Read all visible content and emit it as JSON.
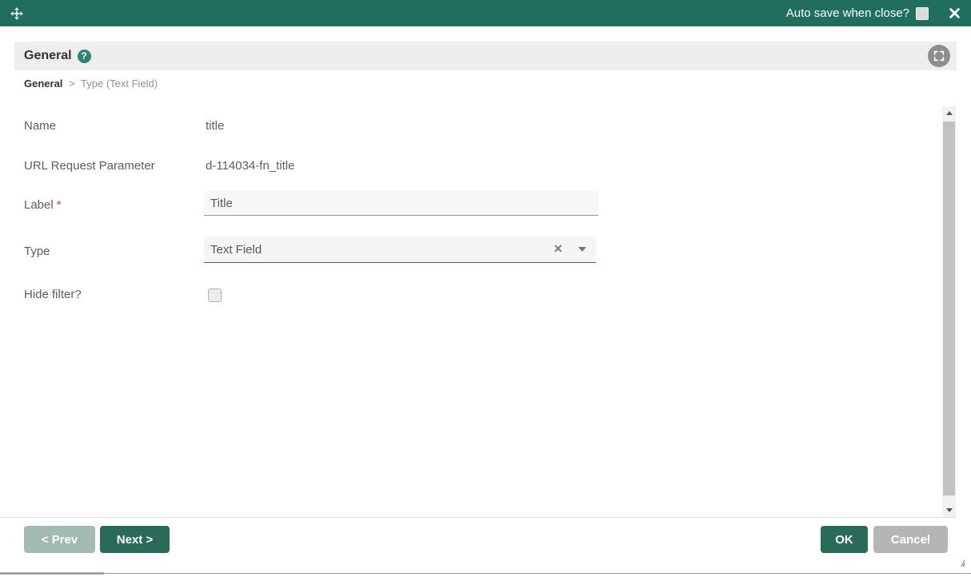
{
  "titlebar": {
    "autosave_label": "Auto save when close?",
    "autosave_checked": false
  },
  "header": {
    "title": "General"
  },
  "breadcrumb": {
    "current": "General",
    "separator": ">",
    "rest": "Type (Text Field)"
  },
  "form": {
    "fields": [
      {
        "label": "Name",
        "value": "title",
        "control": "readonly-text"
      },
      {
        "label": "URL Request Parameter",
        "value": "d-114034-fn_title",
        "control": "readonly-text"
      },
      {
        "label": "Label",
        "required_mark": "*",
        "value": "Title",
        "control": "text-input"
      },
      {
        "label": "Type",
        "value": "Text Field",
        "control": "select"
      },
      {
        "label": "Hide filter?",
        "checked": false,
        "control": "checkbox"
      }
    ]
  },
  "footer": {
    "prev_label": "< Prev",
    "next_label": "Next >",
    "ok_label": "OK",
    "cancel_label": "Cancel"
  },
  "icons": {
    "move": "move-icon",
    "close": "close-icon",
    "help_glyph": "?",
    "expand": "fullscreen-expand-icon",
    "clear_glyph": "×",
    "dropdown": "chevron-down-icon",
    "resize": "resize-handle"
  },
  "colors": {
    "titlebar_bg": "#1f6e5e",
    "primary_button_bg": "#2a6a59",
    "disabled_button_bg": "#a1bbb0",
    "cancel_button_bg": "#b5b5b5",
    "section_header_bg": "#eeeeee",
    "help_icon_bg": "#2f8274",
    "required_asterisk": "#e53935",
    "scrollbar_track": "#f1f1f1",
    "scrollbar_thumb": "#c2c2c2"
  }
}
